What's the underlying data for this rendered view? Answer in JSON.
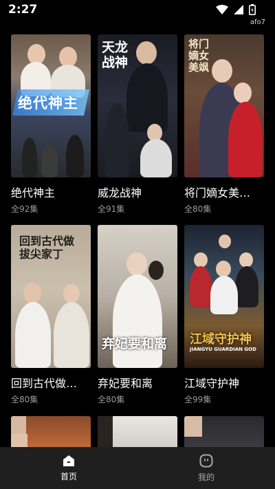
{
  "status": {
    "time": "2:27",
    "sub": "afo7"
  },
  "dramas": [
    {
      "title": "绝代神主",
      "count": "全92集",
      "poster_text": "绝代神主"
    },
    {
      "title": "威龙战神",
      "count": "全91集",
      "poster_text": "天龙战神"
    },
    {
      "title": "将门嫡女美…",
      "count": "全80集",
      "poster_text": "将门嫡女美飒"
    },
    {
      "title": "回到古代做…",
      "count": "全80集",
      "poster_text": "回到古代做拔尖家丁"
    },
    {
      "title": "弃妃要和离",
      "count": "全80集",
      "poster_text": "弃妃要和离"
    },
    {
      "title": "江域守护神",
      "count": "全99集",
      "poster_text": "江域守护神",
      "poster_subtext": "JIANGYU GUARDIAN GOD"
    }
  ],
  "tabs": {
    "home": "首页",
    "me": "我的"
  },
  "colors": {
    "background": "#000000",
    "tabbar": "#1f1f1f",
    "subtext": "#9a9a9a"
  }
}
